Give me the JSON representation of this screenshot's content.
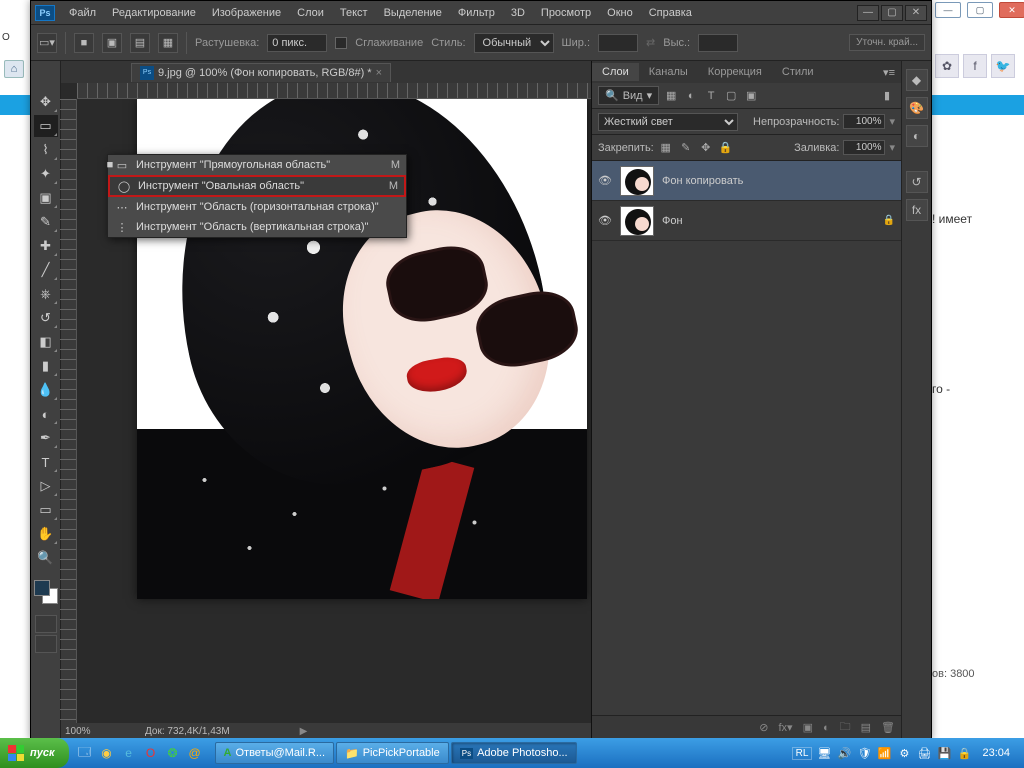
{
  "bg": {
    "strip": "",
    "t1": "! имеет",
    "t2": "го\n-",
    "t3": "ов: 3800"
  },
  "menu": [
    "Файл",
    "Редактирование",
    "Изображение",
    "Слои",
    "Текст",
    "Выделение",
    "Фильтр",
    "3D",
    "Просмотр",
    "Окно",
    "Справка"
  ],
  "opt": {
    "feather_lbl": "Растушевка:",
    "feather": "0 пикс.",
    "aa": "Сглаживание",
    "style_lbl": "Стиль:",
    "style": "Обычный",
    "width_lbl": "Шир.:",
    "height_lbl": "Выс.:",
    "refine": "Уточн. край..."
  },
  "doc": {
    "title": "9.jpg @ 100% (Фон копировать, RGB/8#) *"
  },
  "flyout": [
    {
      "icon": "▭",
      "label": "Инструмент \"Прямоугольная область\"",
      "sc": "M",
      "sel": true
    },
    {
      "icon": "◯",
      "label": "Инструмент \"Овальная область\"",
      "sc": "M",
      "hl": true
    },
    {
      "icon": "⋯",
      "label": "Инструмент \"Область (горизонтальная строка)\"",
      "sc": ""
    },
    {
      "icon": "⋮",
      "label": "Инструмент \"Область (вертикальная строка)\"",
      "sc": ""
    }
  ],
  "status": {
    "zoom": "100%",
    "doc": "Док: 732,4K/1,43M"
  },
  "panels": {
    "tabs": [
      "Слои",
      "Каналы",
      "Коррекция",
      "Стили"
    ],
    "kind": "Вид",
    "blend": "Жесткий свет",
    "opacity_lbl": "Непрозрачность:",
    "opacity": "100%",
    "lock_lbl": "Закрепить:",
    "fill_lbl": "Заливка:",
    "fill": "100%",
    "layers": [
      {
        "name": "Фон копировать",
        "sel": true,
        "locked": false
      },
      {
        "name": "Фон",
        "sel": false,
        "locked": true
      }
    ]
  },
  "taskbar": {
    "start": "пуск",
    "tasks": [
      {
        "icon": "A",
        "label": "Ответы@Mail.R...",
        "active": false,
        "color": "#3a3"
      },
      {
        "icon": "📁",
        "label": "PicPickPortable",
        "active": false,
        "color": "#fc6"
      },
      {
        "icon": "Ps",
        "label": "Adobe Photosho...",
        "active": true,
        "color": "#2a6fab"
      }
    ],
    "lang": "RL",
    "clock": "23:04"
  },
  "leftsliver": "О"
}
